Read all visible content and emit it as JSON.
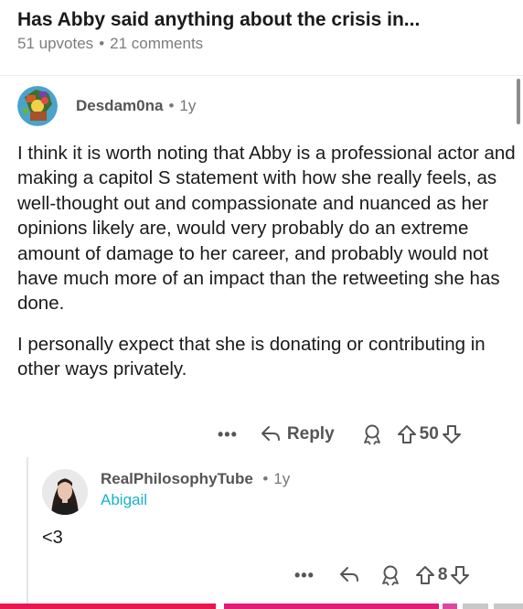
{
  "post": {
    "title": "Has Abby said anything about the crisis in...",
    "upvotes": "51 upvotes",
    "separator": "•",
    "comments": "21 comments"
  },
  "comment": {
    "author": "Desdam0na",
    "separator": "•",
    "age": "1y",
    "avatar_icon": "snoo-avatar-icon",
    "paragraphs": [
      "I think it is worth noting that Abby is a professional actor and making a capitol S statement with how she really feels, as well-thought out and compassionate and nuanced as her opinions likely are, would very probably do an extreme amount of damage to her career, and probably would not have much more of an impact than the retweeting she has done.",
      "I personally expect that she is donating or contributing in other ways privately."
    ],
    "actions": {
      "more": "•••",
      "reply_label": "Reply",
      "votes": "50"
    }
  },
  "reply": {
    "author": "RealPhilosophyTube",
    "separator": "•",
    "age": "1y",
    "flair": "Abigail",
    "avatar_icon": "user-photo-avatar",
    "body": "<3",
    "actions": {
      "more": "•••",
      "votes": "8"
    }
  },
  "colors": {
    "flair": "#19b3c8",
    "meta_gray": "#7c7c7c",
    "action_gray": "#555555",
    "bottom_bar_red": "#e8174f",
    "bottom_bar_pink": "#e11d74"
  }
}
